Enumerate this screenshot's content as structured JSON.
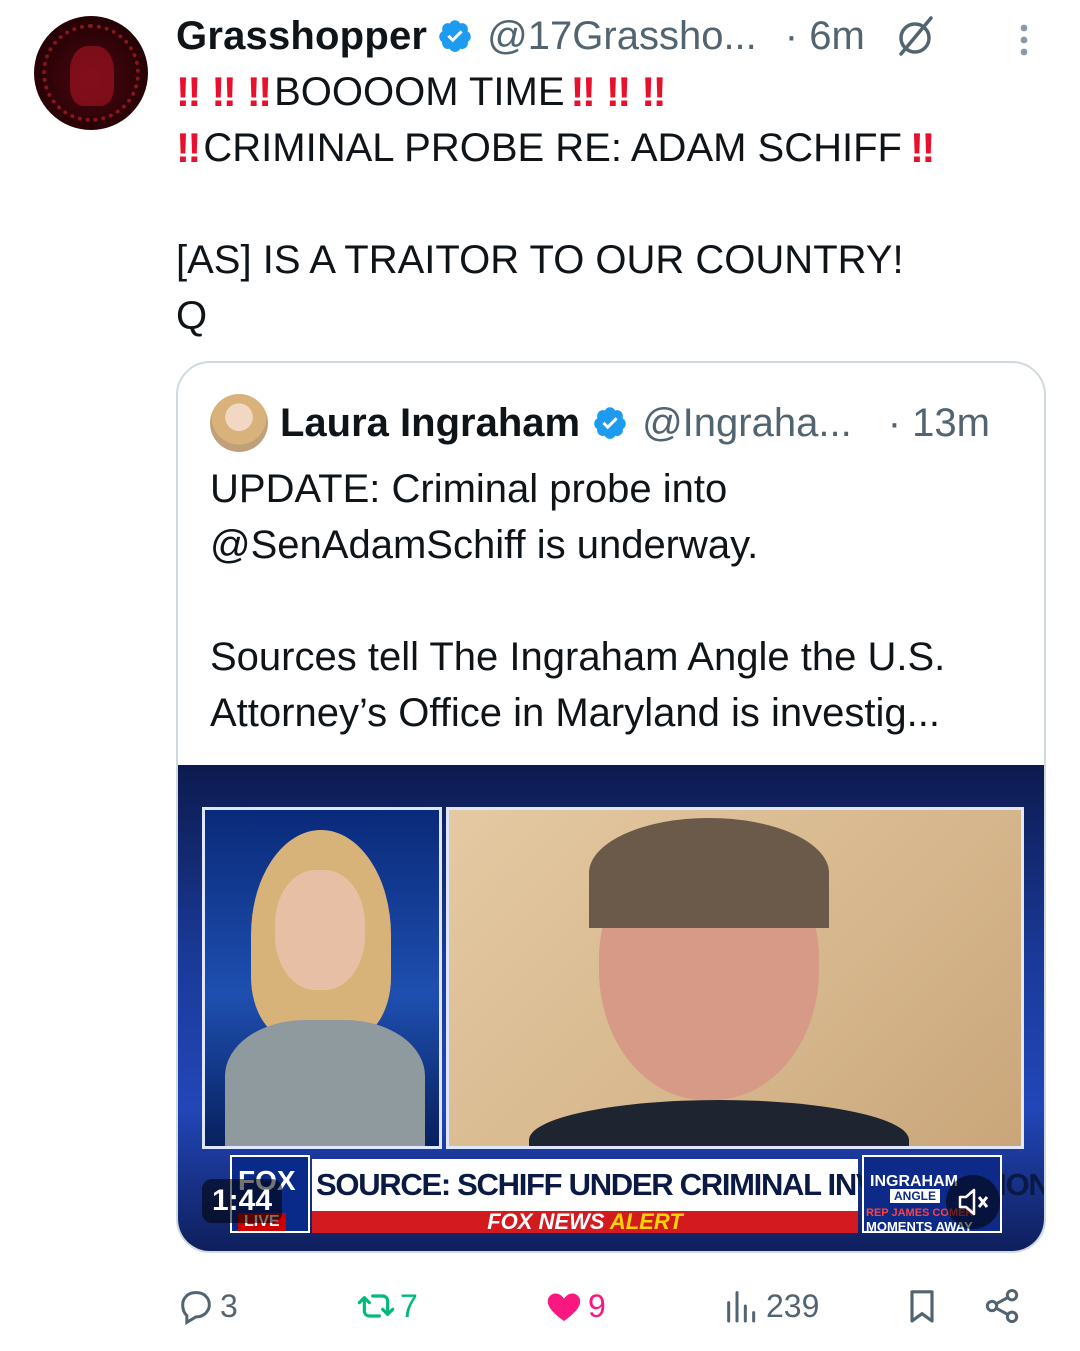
{
  "author": {
    "name": "Grasshopper",
    "handle": "@17Grassho...",
    "time": "· 6m"
  },
  "tweet": {
    "line1_text": "BOOOOM TIME",
    "line2_text": "CRIMINAL PROBE RE: ADAM SCHIFF",
    "line3_text": "[AS] IS A TRAITOR TO OUR COUNTRY!",
    "line4_text": "Q",
    "emoji": "‼"
  },
  "quoted": {
    "name": "Laura Ingraham",
    "handle": "@Ingraha...",
    "time": "· 13m",
    "para1_line1": "UPDATE: Criminal probe into",
    "para1_line2": "@SenAdamSchiff is underway.",
    "para2_line1": "Sources tell The Ingraham Angle the U.S.",
    "para2_line2": "Attorney’s Office in Maryland is investig..."
  },
  "video": {
    "duration": "1:44",
    "headline": "SOURCE: SCHIFF UNDER CRIMINAL INVESTIGATION",
    "alert_prefix": "FOX NEWS ",
    "alert_suffix": "ALERT",
    "fox_label": "FOX",
    "fox_live": "LIVE",
    "show_title": "INGRAHAM",
    "show_sub": "ANGLE",
    "ticker_top": "REP JAMES COMER",
    "ticker_bottom": "MOMENTS AWAY"
  },
  "actions": {
    "replies": "3",
    "reposts": "7",
    "likes": "9",
    "views": "239"
  },
  "colors": {
    "accent_blue": "#1d9bf0",
    "repost_green": "#00ba7c",
    "like_pink": "#f91880",
    "emoji_red": "#e8112d"
  }
}
